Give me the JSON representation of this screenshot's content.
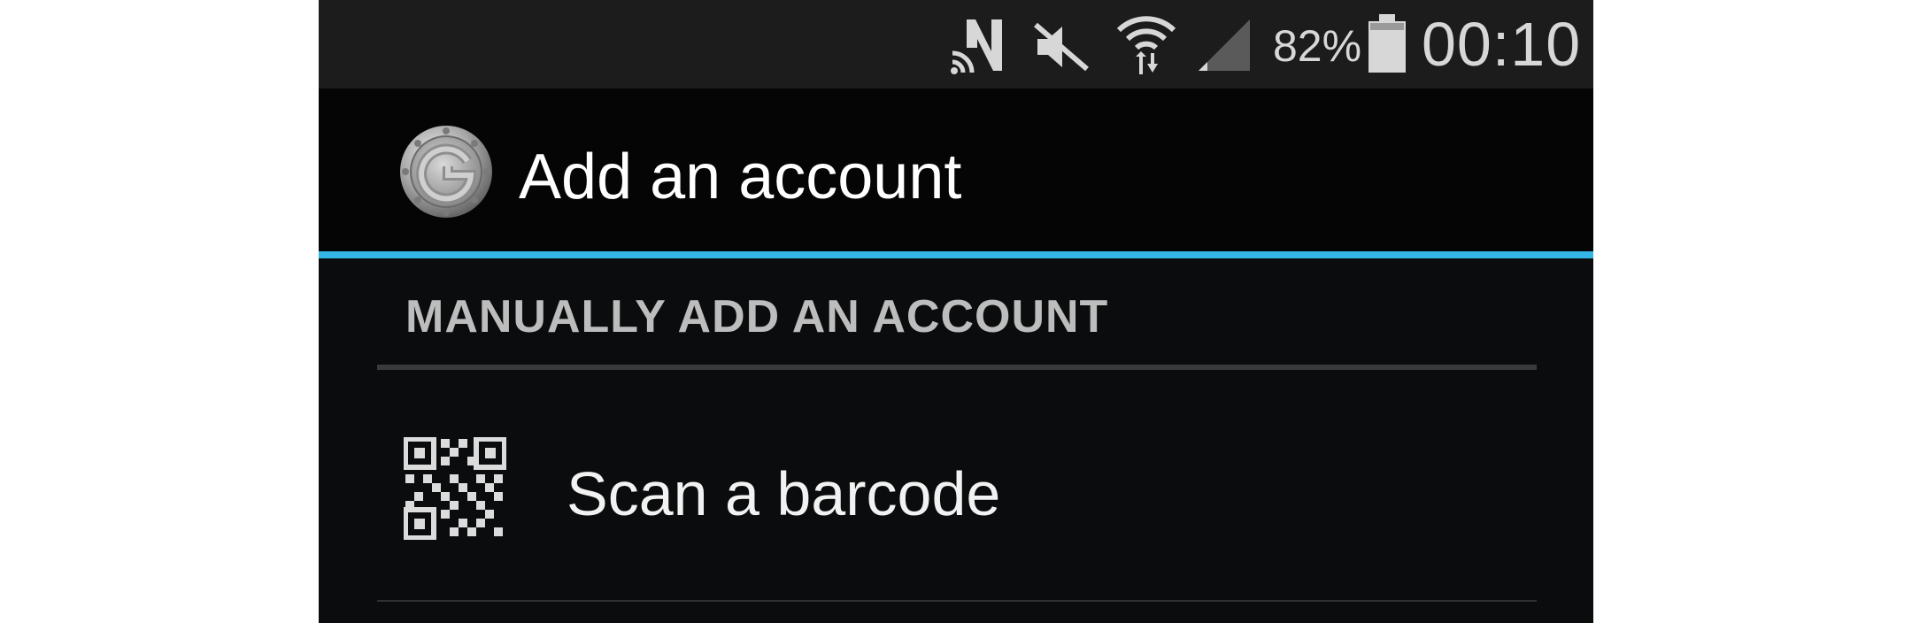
{
  "status_bar": {
    "battery_percent": "82%",
    "time": "00:10",
    "icons": [
      "nfc-icon",
      "mute-icon",
      "wifi-icon",
      "signal-icon",
      "battery-icon"
    ]
  },
  "action_bar": {
    "title": "Add an account",
    "logo_icon": "authenticator-logo-icon"
  },
  "colors": {
    "accent": "#33b5e5",
    "background": "#0b0c0d",
    "status_bar": "#1c1c1c",
    "section_header_text": "#bdbdbd"
  },
  "content": {
    "section_header": "MANUALLY ADD AN ACCOUNT",
    "items": [
      {
        "label": "Scan a barcode",
        "icon": "qr-code-icon"
      }
    ]
  }
}
